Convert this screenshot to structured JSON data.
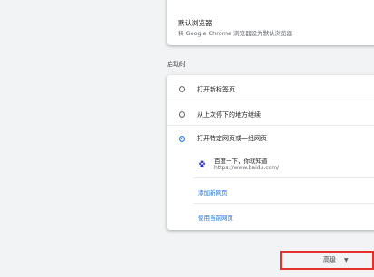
{
  "default_browser": {
    "title": "默认浏览器",
    "subtitle": "将 Google Chrome 浏览器设为默认浏览器"
  },
  "startup": {
    "section_title": "启动时",
    "options": [
      {
        "label": "打开新标签页",
        "checked": false
      },
      {
        "label": "从上次停下的地方继续",
        "checked": false
      },
      {
        "label": "打开特定网页或一组网页",
        "checked": true
      }
    ],
    "site": {
      "icon": "baidu-paw-icon",
      "title": "百度一下，你就知道",
      "url": "https://www.baidu.com/"
    },
    "add_page_label": "添加新网页",
    "use_current_label": "使用当前网页"
  },
  "advanced": {
    "label": "高级",
    "icon": "caret-down-icon",
    "highlight_color": "#e5312a"
  },
  "colors": {
    "accent": "#1a73e8",
    "background": "#f1f3f4"
  }
}
